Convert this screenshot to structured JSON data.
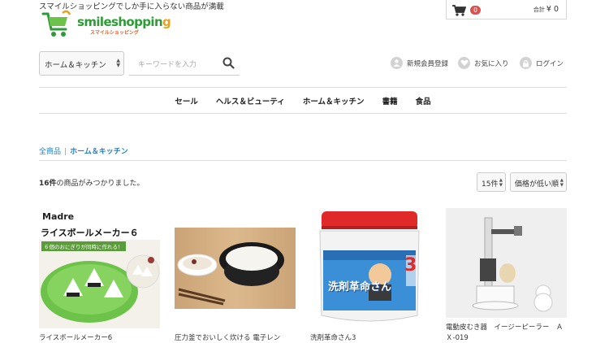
{
  "header": {
    "tagline": "スマイルショッピングでしか手に入らない商品が満載",
    "logo": {
      "main_pre": "smileshoppin",
      "main_o": "g",
      "sub": "スマイルショッピング"
    },
    "cart": {
      "count": "0",
      "total_label": "合計",
      "total_value": "¥ 0"
    }
  },
  "search": {
    "category_selected": "ホーム＆キッチン",
    "placeholder": "キーワードを入力"
  },
  "user_links": {
    "register": "新規会員登録",
    "favorites": "お気に入り",
    "login": "ログイン"
  },
  "nav": {
    "items": [
      "セール",
      "ヘルス＆ビューティ",
      "ホーム＆キッチン",
      "書籍",
      "食品"
    ]
  },
  "breadcrumb": {
    "all": "全商品",
    "separator": "|",
    "current": "ホーム＆キッチン"
  },
  "results": {
    "count": "16件",
    "suffix": "の商品がみつかりました。",
    "per_page": "15件",
    "sort": "価格が低い順"
  },
  "products": [
    {
      "name": "ライスボールメーカー6",
      "image_brand": "Madre",
      "image_title": "ライスボールメーカー６",
      "image_caption": "６個のおにぎりが同時に作れる！"
    },
    {
      "name": "圧力釜でおいしく炊ける 電子レン"
    },
    {
      "name": "洗剤革命さん3",
      "image_label": "洗剤革命さん",
      "image_number": "3"
    },
    {
      "name": "電動皮むき器　イージーピーラー　ＡＸ-019"
    }
  ],
  "colors": {
    "accent_blue": "#2a7fc1",
    "logo_green": "#2f9a38",
    "badge_red": "#d9534f",
    "product_green": "#6dc34a"
  }
}
